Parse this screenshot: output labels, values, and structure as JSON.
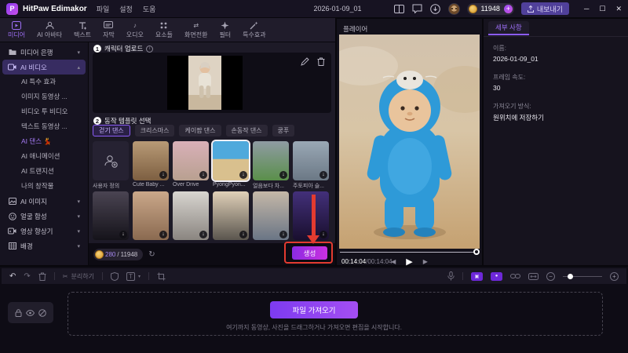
{
  "titlebar": {
    "app_name": "HitPaw Edimakor",
    "menus": [
      "파일",
      "설정",
      "도움"
    ],
    "document_title": "2026-01-09_01",
    "coin_balance": "11948",
    "coin_add": "+",
    "export_label": "내보내기",
    "window_buttons": {
      "minimize": "─",
      "maximize": "☐",
      "close": "✕"
    }
  },
  "media_toolbar": {
    "tabs": [
      {
        "label": "미디어"
      },
      {
        "label": "AI 아바타"
      },
      {
        "label": "텍스트"
      },
      {
        "label": "자막"
      },
      {
        "label": "오디오"
      },
      {
        "label": "요소들"
      },
      {
        "label": "화면전환"
      },
      {
        "label": "필터"
      },
      {
        "label": "특수효과"
      }
    ]
  },
  "sidebar": {
    "items": [
      {
        "label": "미디어 은행"
      },
      {
        "label": "AI 비디오"
      },
      {
        "label": "AI 특수 효과"
      },
      {
        "label": "이미지 동영상 ..."
      },
      {
        "label": "비디오 투 비디오"
      },
      {
        "label": "텍스트 동영상 ..."
      },
      {
        "label": "AI 댄스",
        "emoji": "💃"
      },
      {
        "label": "AI 애니메이션"
      },
      {
        "label": "AI 트랜지션"
      },
      {
        "label": "나의 창작물"
      },
      {
        "label": "AI 이미지"
      },
      {
        "label": "얼굴 합성"
      },
      {
        "label": "영상 향상기"
      },
      {
        "label": "배경"
      }
    ]
  },
  "main": {
    "step1": {
      "number": "1",
      "title": "캐릭터 업로드"
    },
    "step2": {
      "number": "2",
      "title": "동작 템플릿 선택"
    },
    "category_tabs": [
      "걷기 댄스",
      "크리스마스",
      "케이팝 댄스",
      "손동작 댄스",
      "쿵푸"
    ],
    "templates_row1": [
      "사용자 정의",
      "Cute Baby ...",
      "Over Drive",
      "PyongPyon...",
      "얼음보다 차...",
      "주토피아 슬..."
    ],
    "credits": {
      "used": "280",
      "separator": "/",
      "total": "11948"
    },
    "generate_label": "생성"
  },
  "player": {
    "title": "플레이어",
    "current_time": "00:14:04",
    "time_separator": " / ",
    "total_time": "00:14:04"
  },
  "details": {
    "tab_label": "세부 사항",
    "fields": [
      {
        "label": "이름:",
        "value": "2026-01-09_01"
      },
      {
        "label": "프레임 속도:",
        "value": "30"
      },
      {
        "label": "가져오기 방식:",
        "value": "원위치에 저장하기"
      }
    ]
  },
  "timeline": {
    "split_label": "분리하기",
    "import_button_label": "파일 가져오기",
    "drop_hint": "여기까지 동영상, 사진을 드래그하거나 가져오면 편집을 시작합니다."
  },
  "icons": {
    "caret_down": "▾",
    "caret_up": "▴",
    "play": "▶",
    "prev_frame": "◀",
    "next_frame": "▶",
    "undo": "↶",
    "redo": "↷",
    "scissors": "✂",
    "refresh": "↻",
    "note": "♪",
    "swap": "⇄",
    "download": "↓",
    "minus": "−",
    "plus": "+",
    "info": "i",
    "letter_t": "T"
  },
  "colors": {
    "accent": "#8b5cf6",
    "generate_gradient": [
      "#8a2be2",
      "#cb30e0"
    ],
    "annotation_red": "#e33b30",
    "coin_gold": "#d99a2b",
    "costume_blue": "#2e9ad8"
  }
}
